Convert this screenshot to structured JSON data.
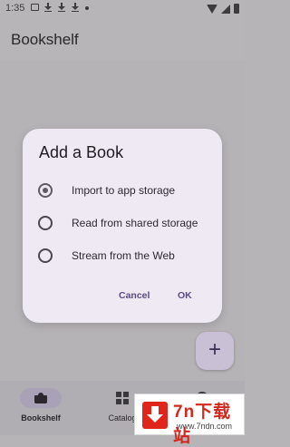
{
  "status_bar": {
    "time": "1:35",
    "notification_icons": [
      "image-icon",
      "download-icon",
      "download-icon",
      "download-icon",
      "dot-icon"
    ],
    "system_icons": [
      "wifi-icon",
      "signal-icon",
      "battery-icon"
    ]
  },
  "app_bar": {
    "title": "Bookshelf"
  },
  "fab": {
    "label": "+",
    "icon": "add-icon"
  },
  "bottom_nav": {
    "items": [
      {
        "label": "Bookshelf",
        "icon": "book-icon",
        "active": true
      },
      {
        "label": "Catalog",
        "icon": "grid-icon",
        "active": false
      }
    ]
  },
  "dialog": {
    "title": "Add a Book",
    "options": [
      {
        "label": "Import to app storage",
        "selected": true
      },
      {
        "label": "Read from shared storage",
        "selected": false
      },
      {
        "label": "Stream from the Web",
        "selected": false
      }
    ],
    "cancel_label": "Cancel",
    "ok_label": "OK"
  },
  "watermark": {
    "brand": "7n下载站",
    "url": "www.7ndn.com"
  },
  "colors": {
    "scrim_background": "#b7b4b8",
    "dialog_surface": "#efe9f3",
    "accent": "#5a4b83",
    "fab_container": "#c9c0d6",
    "watermark_red": "#d2281d"
  }
}
